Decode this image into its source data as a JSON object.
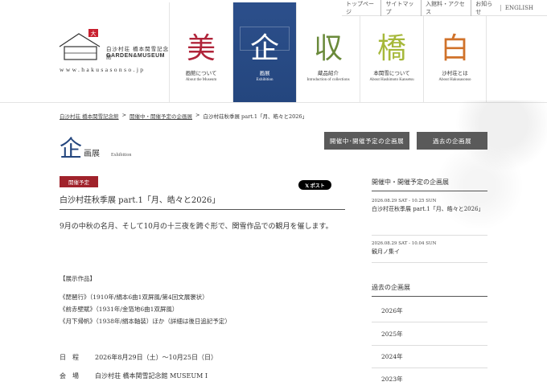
{
  "util_nav": [
    "トップページ",
    "サイトマップ",
    "入館料・アクセス",
    "お知らせ",
    "ENGLISH"
  ],
  "logo": {
    "jp": "白沙村荘 橋本関雪記念館",
    "en": "GARDEN&MUSEUM",
    "url": "www.hakusasonso.jp"
  },
  "main_nav": [
    {
      "big": "美",
      "jp": "画館について",
      "en": "About the Museum",
      "color": "#b0243a"
    },
    {
      "big": "企",
      "jp": "画展",
      "en": "Exhibition",
      "color": "#ffffff"
    },
    {
      "big": "収",
      "jp": "蔵品紹介",
      "en": "Introduction of collections",
      "color": "#6a8a3a"
    },
    {
      "big": "橋",
      "jp": "本関雪について",
      "en": "About Hashimoto Kansetsu",
      "color": "#a6b83a"
    },
    {
      "big": "白",
      "jp": "沙村荘とは",
      "en": "About Hakusasonso",
      "color": "#d0722a"
    }
  ],
  "breadcrumb": [
    "白沙村荘 橋本関雪記念館",
    "開催中・開催予定の企画展",
    "白沙村荘秋季展 part.1「月、皓々と2026」"
  ],
  "page_title": {
    "kanji": "企",
    "rest": "画展",
    "en": "Exhibition"
  },
  "buttons": {
    "current": "開催中･開催予定の企画展",
    "past": "過去の企画展"
  },
  "article": {
    "badge": "開催予定",
    "post": "𝕏 ポスト",
    "title": "白沙村荘秋季展 part.1「月、皓々と2026」",
    "lead": "9月の中秋の名月、そして10月の十三夜を跨ぐ形で、関雪作品での観月を催します。",
    "exhibit_head": "【展示作品】",
    "works": [
      "《琵琶行》（1910年/絹本6曲1双屏風/第4回文展褒状）",
      "《前赤壁賦》（1931年/金箔地6曲1双屏風）",
      "《月下帰帆》（1938年/絹本軸装）ほか（詳細は後日追記予定）"
    ],
    "date_label": "日　程",
    "date_value": "2026年8月29日（土）～10月25日（日）",
    "venue_label": "会　場",
    "venue_value": "白沙村荘 橋本関雪記念館 MUSEUM Ⅰ"
  },
  "sidebar": {
    "current_head": "開催中・開催予定の企画展",
    "current_items": [
      {
        "date": "2026.08.29 SAT - 10.25 SUN",
        "name": "白沙村荘秋季展 part.1「月、皓々と2026」"
      },
      {
        "date": "2026.08.29 SAT - 10.04 SUN",
        "name": "観月ノ集イ"
      }
    ],
    "past_head": "過去の企画展",
    "years": [
      "2026年",
      "2025年",
      "2024年",
      "2023年"
    ]
  }
}
